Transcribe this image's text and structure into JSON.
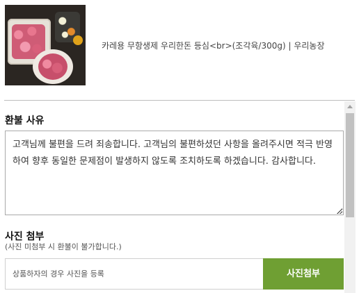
{
  "product": {
    "image_alt": "product-photo",
    "name": "카레용 무항생제 우리한돈 등심<br>(조각육/300g) | 우리농장"
  },
  "refund": {
    "title": "환불 사유",
    "message": "고객님께 불편을 드려 죄송합니다. 고객님의 불편하셨던 사항을 올려주시면 적극 반영하여 향후 동일한 문제점이 발생하지 않도록 조치하도록 하겠습니다. 감사합니다."
  },
  "photo": {
    "title": "사진 첨부",
    "note": "(사진 미첨부 시 환불이 불가합니다.)",
    "placeholder": "상품하자의 경우 사진을 등록",
    "button_label": "사진첨부",
    "button_color": "#6f9f33"
  },
  "icons": {
    "scroll_up": "triangle-up-icon"
  }
}
